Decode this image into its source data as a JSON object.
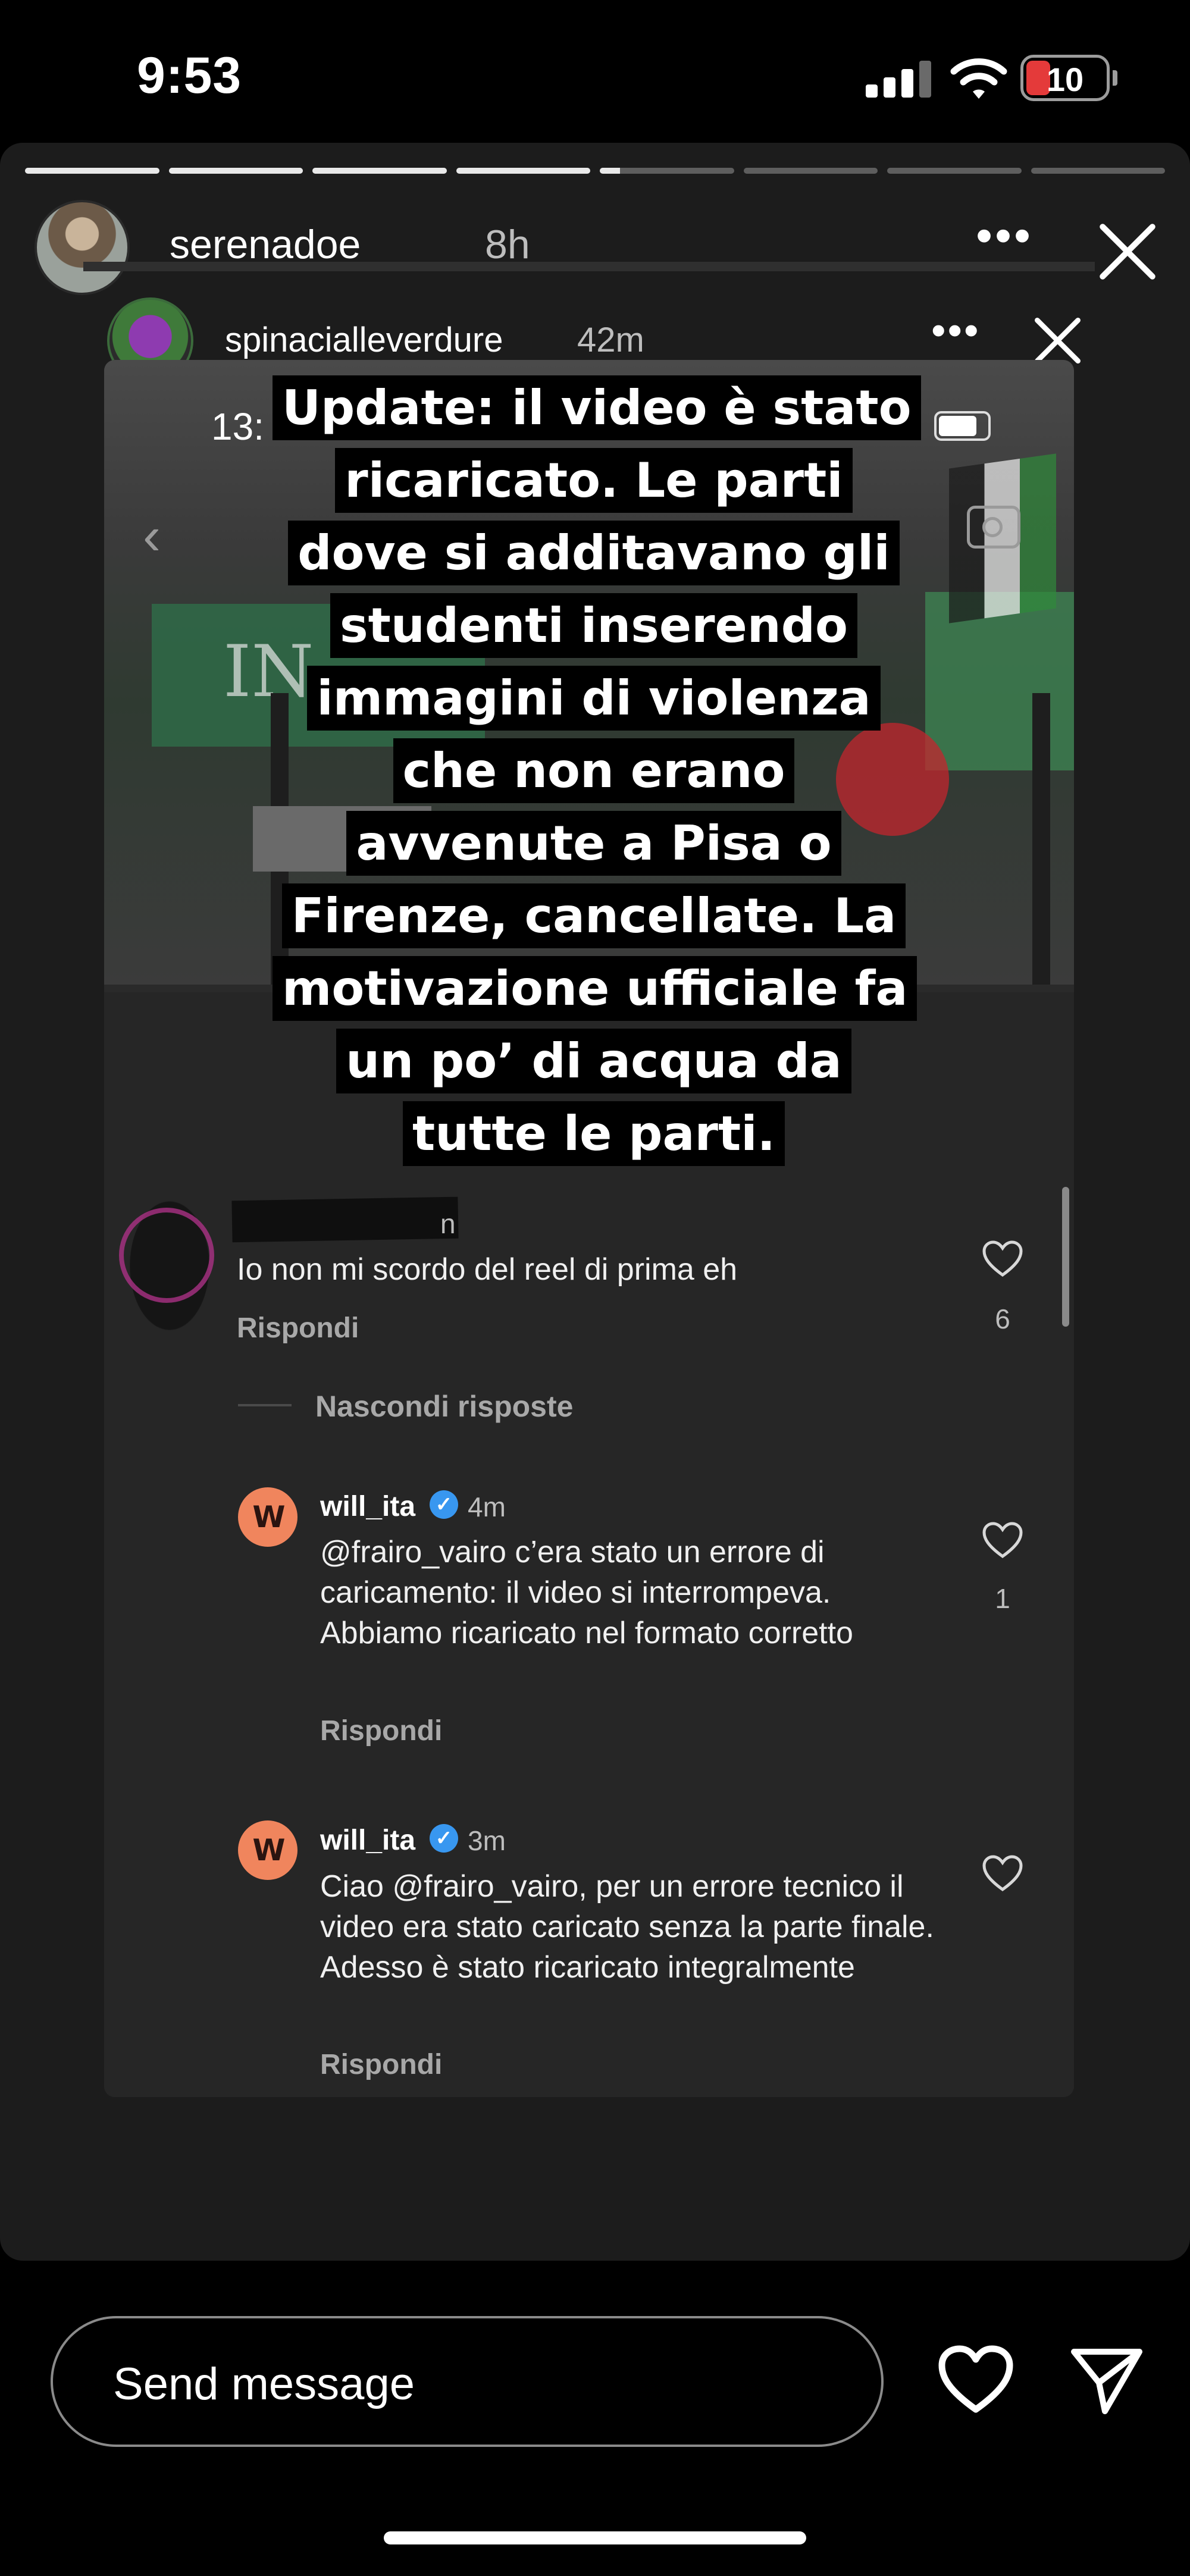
{
  "status_bar": {
    "time": "9:53",
    "battery": "10"
  },
  "story": {
    "username": "serenadoe___",
    "time": "8h",
    "progress": [
      1,
      1,
      1,
      1,
      0.15,
      0,
      0,
      0
    ]
  },
  "reshared": {
    "username": "spinacialleverdure",
    "time": "42m"
  },
  "screenshot": {
    "time": "13:",
    "caption": "Update: il video è stato ricaricato. Le parti dove si additavano gli studenti inserendo immagini di violenza che non erano avvenute a Pisa o Firenze, cancellate. La motivazione ufficiale fa un po’ di acqua da tutte le parti.",
    "video_text": "IN",
    "comment_main": {
      "username_tail": "n",
      "text": "Io non mi scordo del reel di prima eh",
      "reply": "Rispondi",
      "likes": "6"
    },
    "hide_replies": "Nascondi risposte",
    "replies": [
      {
        "username": "will_ita",
        "time": "4m",
        "text": "@frairo_vairo c’era stato un errore di caricamento: il video si interrompeva. Abbiamo ricaricato nel formato corretto",
        "reply": "Rispondi",
        "likes": "1"
      },
      {
        "username": "will_ita",
        "time": "3m",
        "text": "Ciao @frairo_vairo, per un errore tecnico il video era stato caricato senza la parte finale. Adesso è stato ricaricato integralmente",
        "reply": "Rispondi",
        "likes": ""
      }
    ]
  },
  "bottom": {
    "placeholder": "Send message"
  },
  "icons": {
    "more": "more-dots-icon",
    "close": "close-icon",
    "heart": "heart-icon",
    "send": "send-icon",
    "verified": "verified-badge-icon"
  },
  "colors": {
    "background": "#000000",
    "panel": "#262626",
    "will_accent": "#f0855d",
    "verified": "#3897f0",
    "battery_low": "#e43a3a"
  }
}
